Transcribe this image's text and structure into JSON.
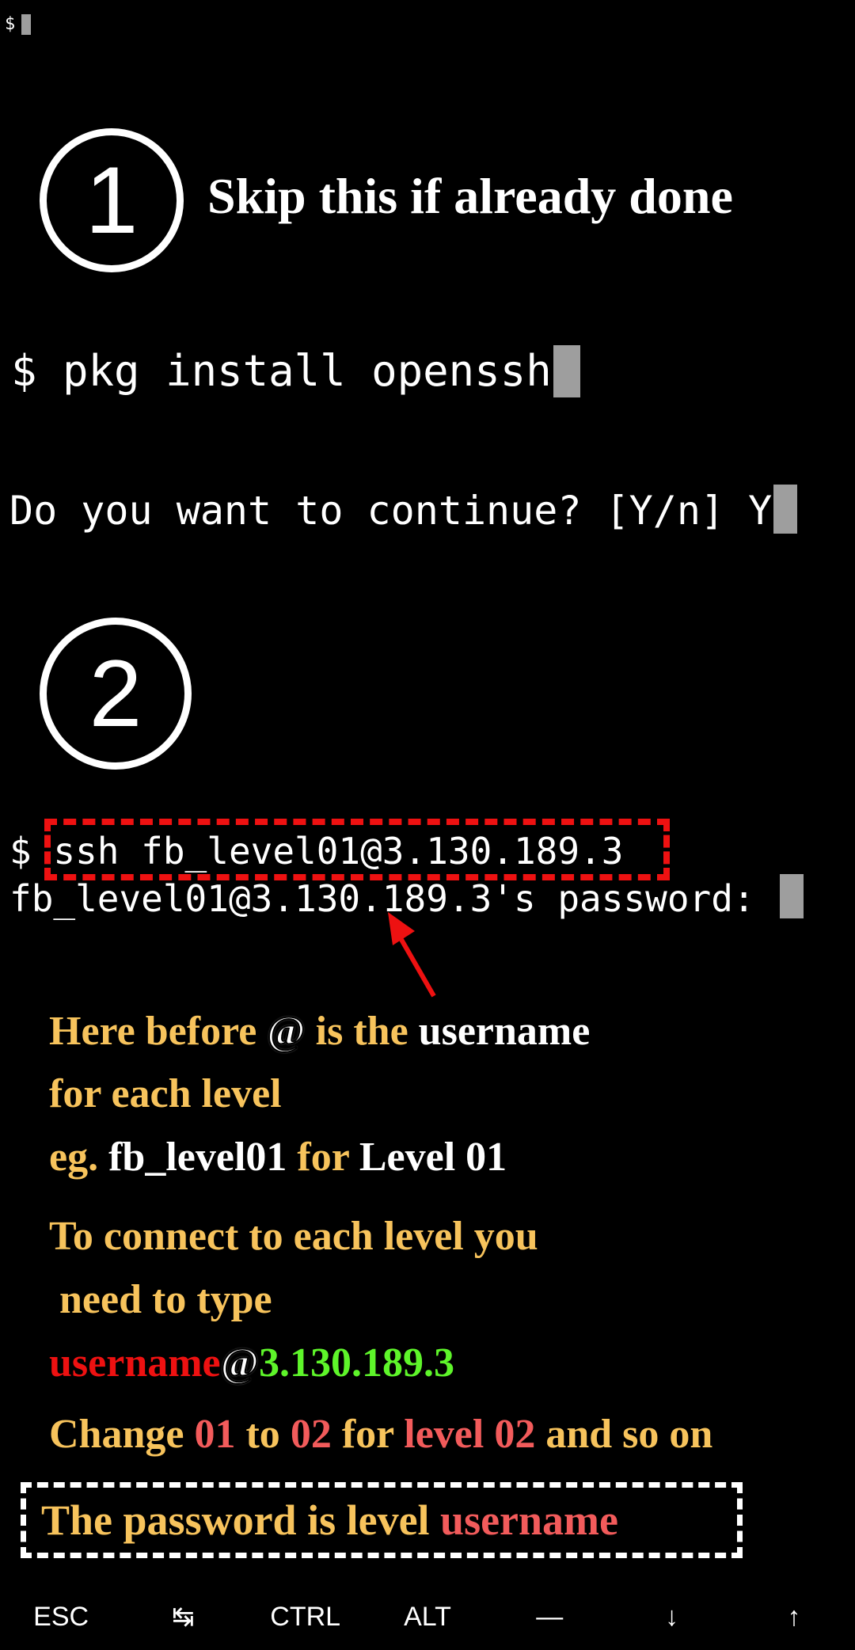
{
  "top_prompt": {
    "symbol": "$"
  },
  "step1": {
    "number": "1",
    "title": "Skip this if already done",
    "command": "$ pkg install openssh",
    "confirm": "Do you want to continue? [Y/n] Y"
  },
  "step2": {
    "number": "2",
    "prompt_symbol": "$ ",
    "ssh_command": "ssh fb_level01@3.130.189.3",
    "password_prompt": "fb_level01@3.130.189.3's password: "
  },
  "notes": {
    "line1": {
      "a": "Here before ",
      "b": "@",
      "c": " is the ",
      "d": "username"
    },
    "line2": {
      "a": "for each level"
    },
    "line3": {
      "a": "eg. ",
      "b": "fb_level01",
      "c": " for ",
      "d": "Level 01"
    },
    "line4": {
      "a": "To connect to each level you"
    },
    "line5": {
      "a": " need to type"
    },
    "line6": {
      "a": "username",
      "b": "@",
      "c": "3.130.189.3"
    },
    "line7": {
      "a": "Change ",
      "b": "01",
      "c": " to ",
      "d": "02",
      "e": " for ",
      "f": "level 02",
      "g": " and so on"
    },
    "line8": {
      "a": "The password is level ",
      "b": "username"
    }
  },
  "extra_keys": [
    {
      "label": "ESC",
      "icon": ""
    },
    {
      "label": "↹",
      "icon": "tab-icon"
    },
    {
      "label": "CTRL",
      "icon": ""
    },
    {
      "label": "ALT",
      "icon": ""
    },
    {
      "label": "—",
      "icon": "dash-icon"
    },
    {
      "label": "↓",
      "icon": "arrow-down-icon"
    },
    {
      "label": "↑",
      "icon": "arrow-up-icon"
    }
  ],
  "colors": {
    "background": "#000000",
    "cursor": "#9e9e9e",
    "note_yellow": "#f7c35c",
    "highlight_red": "#ee1111",
    "ip_green": "#5ef52a",
    "accent_salmon": "#f25b5b"
  }
}
